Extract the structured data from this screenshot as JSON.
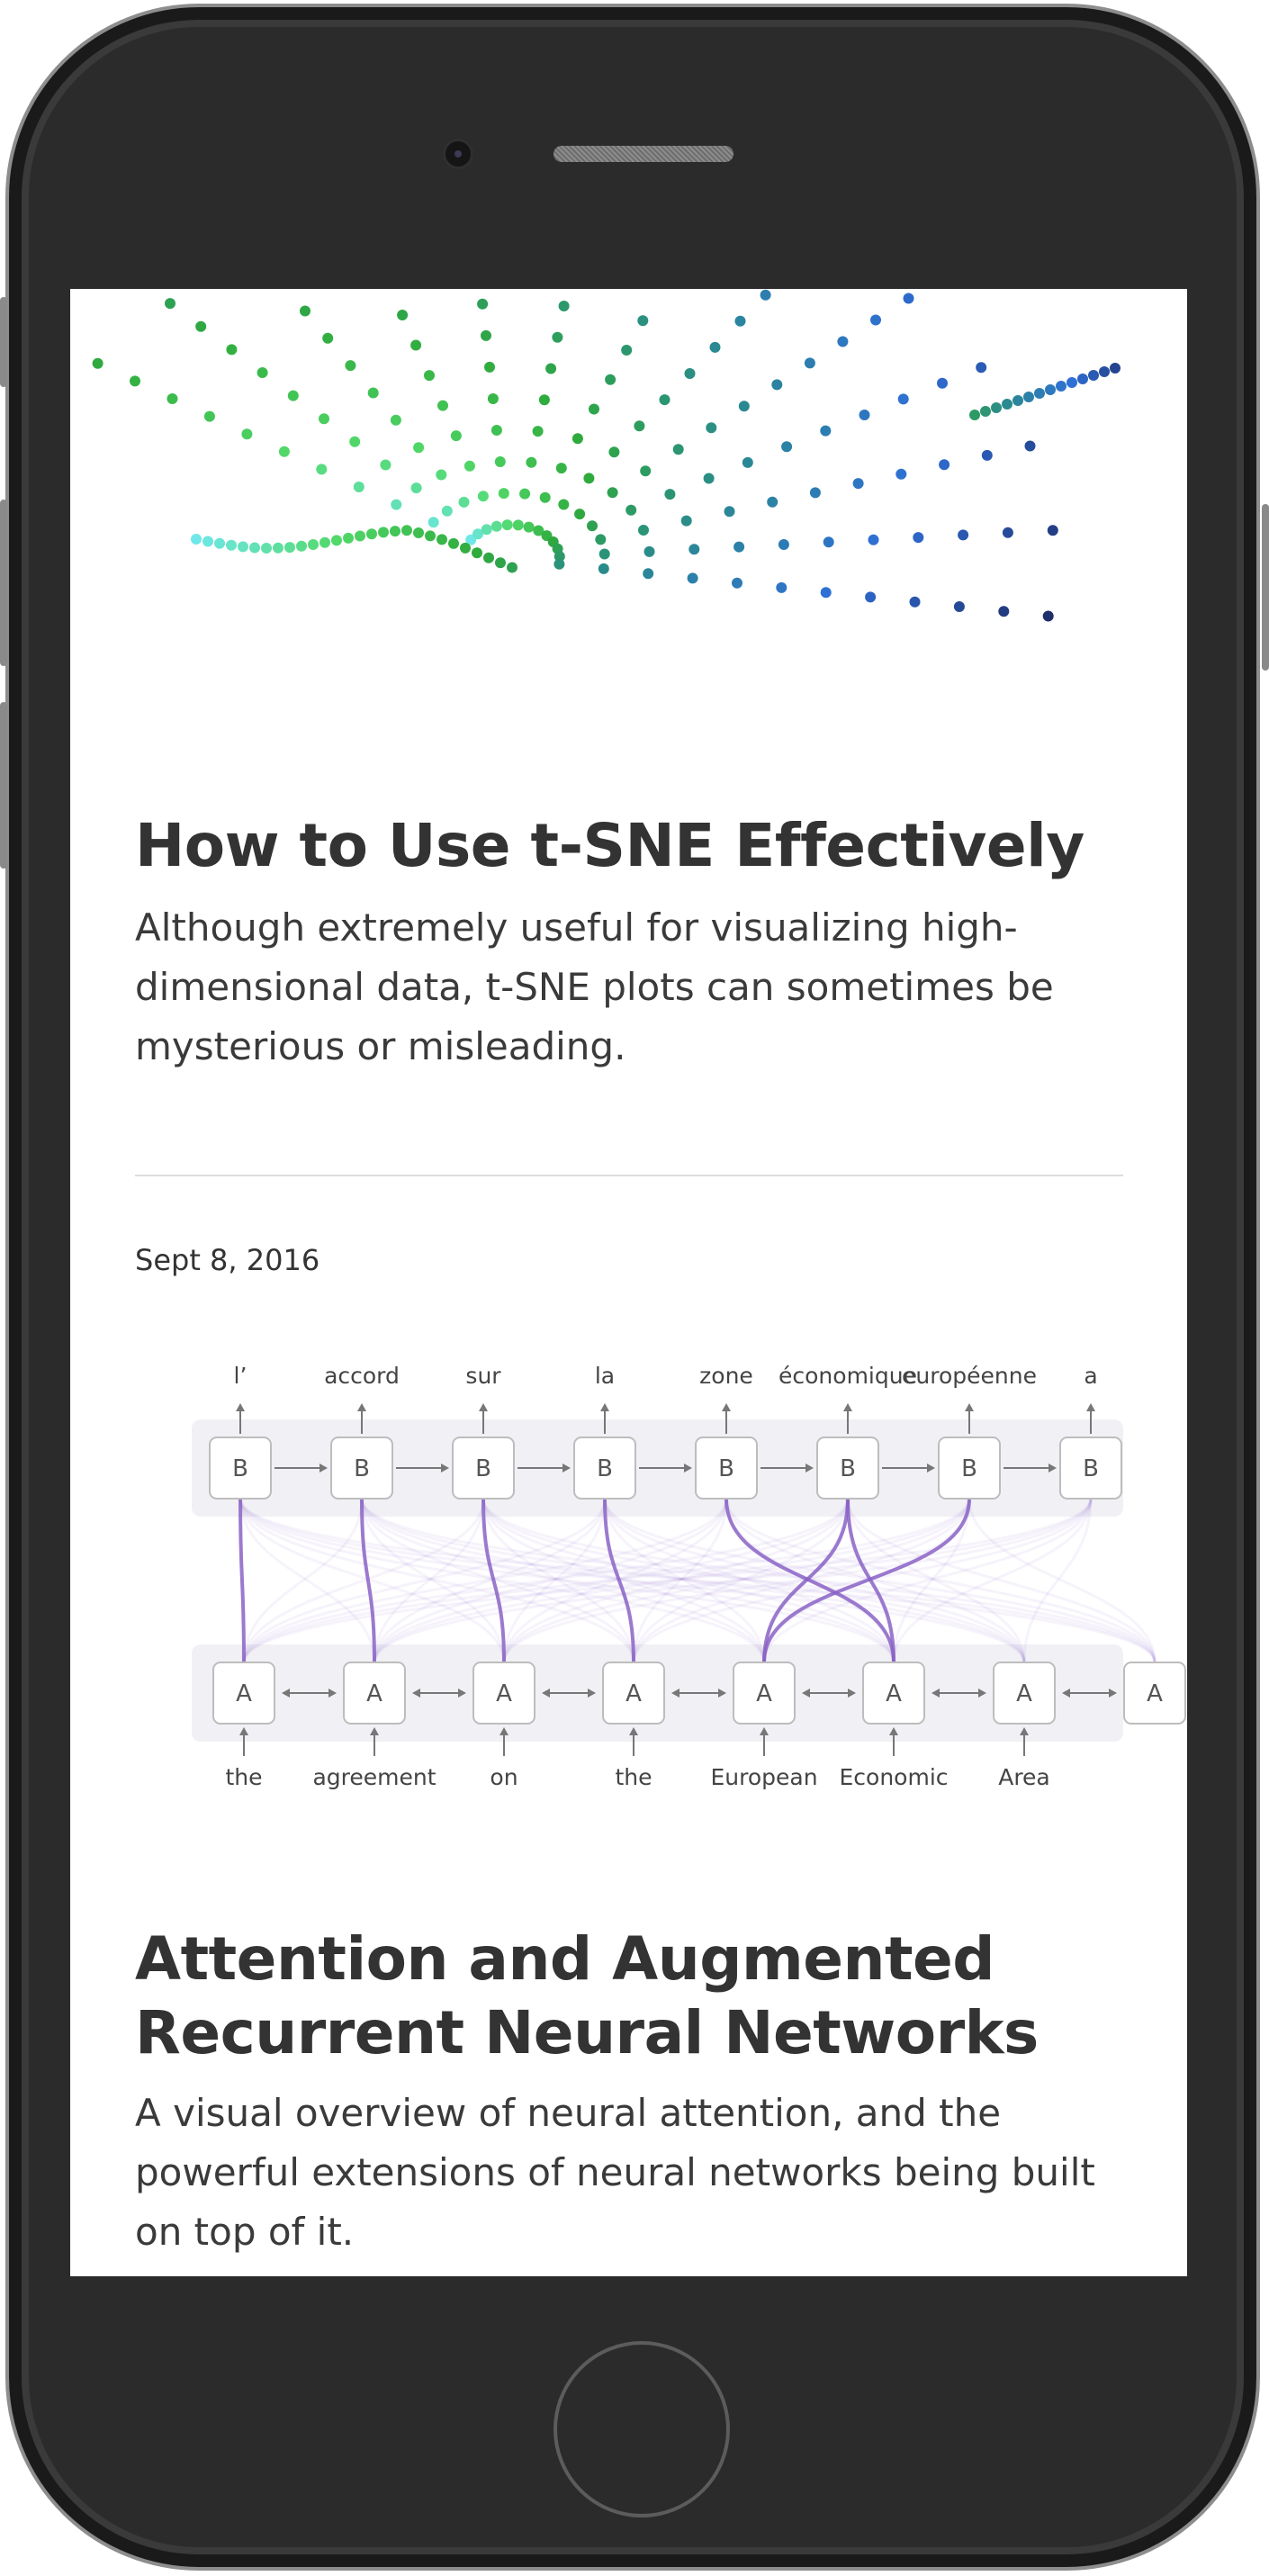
{
  "articles": [
    {
      "title": "How to Use t-SNE Effectively",
      "description": "Although extremely useful for visualizing high-dimensional data, t-SNE plots can sometimes be mysterious or misleading."
    },
    {
      "date": "Sept 8, 2016",
      "title": "Attention and Augmented Recurrent Neural Networks",
      "description": "A visual overview of neural attention, and the powerful extensions of neural networks being built on top of it."
    }
  ],
  "attention_diagram": {
    "output_words": [
      "l’",
      "accord",
      "sur",
      "la",
      "zone",
      "économique",
      "européenne",
      "a"
    ],
    "input_words": [
      "the",
      "agreement",
      "on",
      "the",
      "European",
      "Economic",
      "Area"
    ],
    "decoder_cell_label": "B",
    "encoder_cell_label": "A",
    "accent_color": "#8a63c6"
  },
  "tsne_colors": [
    "#6fe7e9",
    "#52d96a",
    "#2faa3c",
    "#2a8a8f",
    "#2f6fd6",
    "#1f2f6b"
  ]
}
